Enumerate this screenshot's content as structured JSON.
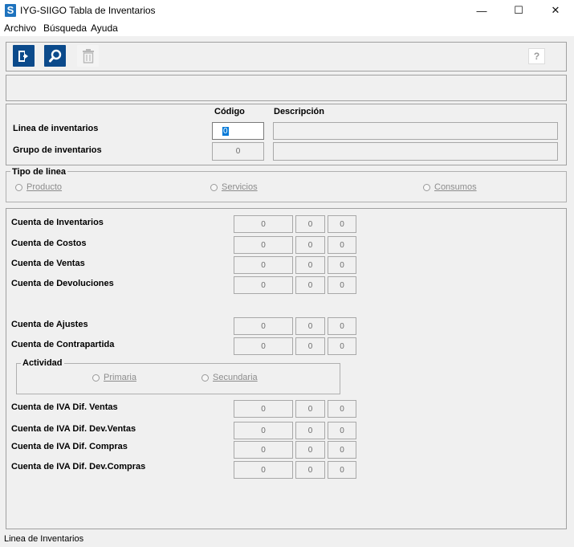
{
  "window": {
    "title": "IYG-SIIGO Tabla de Inventarios",
    "icon_letter": "S",
    "minimize_glyph": "—",
    "maximize_glyph": "☐",
    "close_glyph": "✕"
  },
  "menu": [
    "Archivo",
    "Búsqueda",
    "Ayuda"
  ],
  "toolbar": {
    "help_label": "?"
  },
  "header": {
    "col_code": "Código",
    "col_desc": "Descripción",
    "linea_label": "Linea de inventarios",
    "linea_code": "0",
    "grupo_label": "Grupo de inventarios",
    "grupo_code": "0"
  },
  "tipo_linea": {
    "title": "Tipo de linea",
    "options": [
      "Producto",
      "Servicios",
      "Consumos"
    ]
  },
  "accounts": {
    "rows": [
      {
        "label": "Cuenta de Inventarios",
        "values": [
          "0",
          "0",
          "0"
        ]
      },
      {
        "label": "Cuenta de Costos",
        "values": [
          "0",
          "0",
          "0"
        ]
      },
      {
        "label": "Cuenta de Ventas",
        "values": [
          "0",
          "0",
          "0"
        ]
      },
      {
        "label": "Cuenta de Devoluciones",
        "values": [
          "0",
          "0",
          "0"
        ]
      },
      {
        "label": "Cuenta de Ajustes",
        "values": [
          "0",
          "0",
          "0"
        ]
      },
      {
        "label": "Cuenta de Contrapartida",
        "values": [
          "0",
          "0",
          "0"
        ]
      },
      {
        "label": "Cuenta de IVA Dif. Ventas",
        "values": [
          "0",
          "0",
          "0"
        ]
      },
      {
        "label": "Cuenta de IVA Dif. Dev.Ventas",
        "values": [
          "0",
          "0",
          "0"
        ]
      },
      {
        "label": "Cuenta de IVA Dif. Compras",
        "values": [
          "0",
          "0",
          "0"
        ]
      },
      {
        "label": "Cuenta de IVA Dif. Dev.Compras",
        "values": [
          "0",
          "0",
          "0"
        ]
      }
    ]
  },
  "actividad": {
    "title": "Actividad",
    "options": [
      "Primaria",
      "Secundaria"
    ]
  },
  "status": "Linea de Inventarios"
}
